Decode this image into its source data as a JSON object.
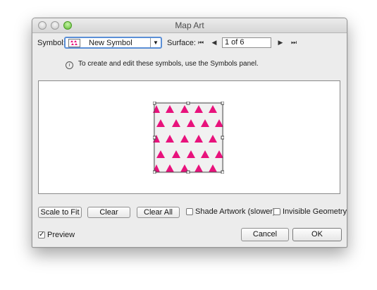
{
  "window": {
    "title": "Map Art"
  },
  "symbol": {
    "label": "Symbol:",
    "selected": "New Symbol"
  },
  "surface": {
    "label": "Surface:",
    "value": "1 of 6"
  },
  "info": {
    "text": "To create and edit these symbols, use the Symbols panel."
  },
  "buttons": {
    "scale_to_fit": "Scale to Fit",
    "clear": "Clear",
    "clear_all": "Clear All",
    "cancel": "Cancel",
    "ok": "OK"
  },
  "checkboxes": {
    "shade_artwork": {
      "label": "Shade Artwork (slower)",
      "checked": false
    },
    "invisible_geometry": {
      "label": "Invisible Geometry",
      "checked": false
    },
    "preview": {
      "label": "Preview",
      "checked": true
    }
  },
  "icons": {
    "nav_first": "skip-first-icon",
    "nav_prev": "triangle-left-icon",
    "nav_next": "triangle-right-icon",
    "nav_last": "skip-last-icon",
    "info": "info-icon",
    "dropdown": "chevron-down-icon"
  },
  "colors": {
    "pattern_triangle": "#e8127c",
    "pattern_background": "#f1f1f1",
    "selection_outline": "#4a4a4a",
    "focus_ring": "#5b8fd6"
  }
}
